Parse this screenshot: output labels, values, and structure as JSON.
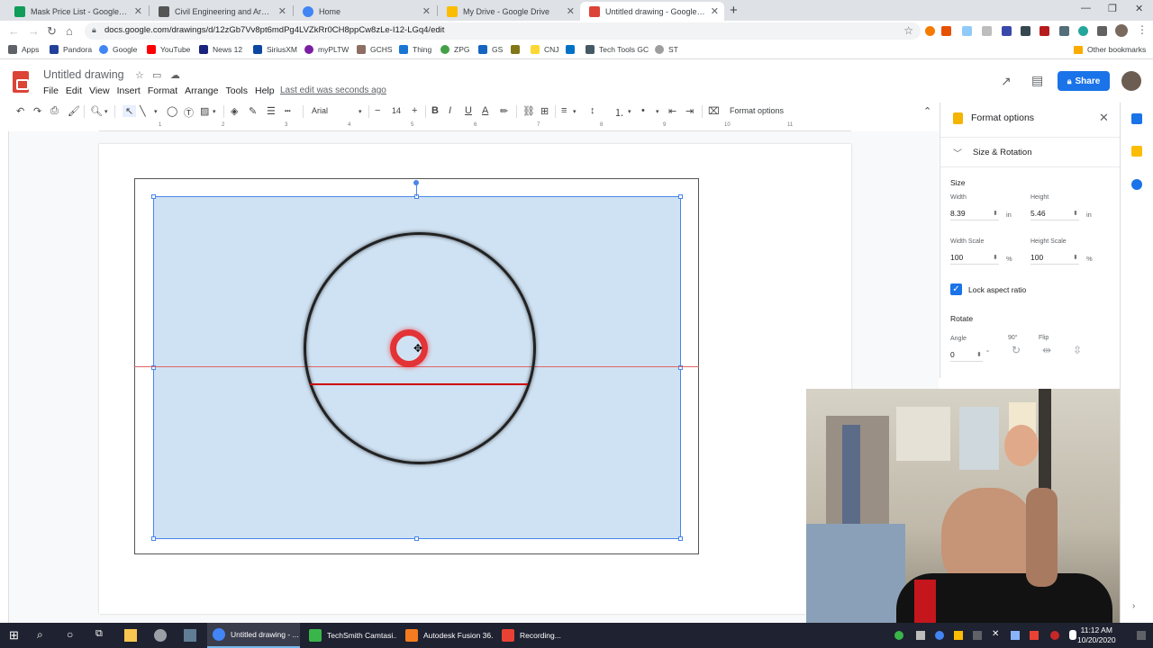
{
  "browser": {
    "tabs": [
      {
        "label": "Mask Price List - Google Sheets",
        "icon": "sheets-icon",
        "color": "#0f9d58",
        "active": false
      },
      {
        "label": "Civil Engineering and Architectu",
        "icon": "cea-icon",
        "color": "#555555",
        "active": false
      },
      {
        "label": "Home",
        "icon": "home-site-icon",
        "color": "#4285f4",
        "active": false
      },
      {
        "label": "My Drive - Google Drive",
        "icon": "drive-icon",
        "color": "#fbbc04",
        "active": false
      },
      {
        "label": "Untitled drawing - Google Drawi",
        "icon": "drawings-icon",
        "color": "#db4437",
        "active": true
      }
    ],
    "url": "docs.google.com/drawings/d/12zGb7Vv8pt6mdPg4LVZkRr0CH8ppCw8zLe-I12-LGq4/edit",
    "bookmarks": [
      "Apps",
      "Pandora",
      "Google",
      "YouTube",
      "News 12",
      "SiriusXM",
      "myPLTW",
      "GCHS",
      "Thing",
      "ZPG",
      "GS",
      "CNJ",
      "Tech Tools GC",
      "ST"
    ],
    "other_bookmarks": "Other bookmarks"
  },
  "doc": {
    "title": "Untitled drawing",
    "menu": [
      "File",
      "Edit",
      "View",
      "Insert",
      "Format",
      "Arrange",
      "Tools",
      "Help"
    ],
    "last_edit": "Last edit was seconds ago",
    "share_label": "Share",
    "share_icon": "lock-icon"
  },
  "toolbar": {
    "font": "Arial",
    "font_size": "14",
    "format_options": "Format options"
  },
  "ruler": {
    "numbers": [
      "1",
      "2",
      "3",
      "4",
      "5",
      "6",
      "7",
      "8",
      "9",
      "10",
      "11"
    ]
  },
  "format_panel": {
    "title": "Format options",
    "section": "Size & Rotation",
    "size_heading": "Size",
    "width_label": "Width",
    "width_value": "8.39",
    "width_unit": "in",
    "height_label": "Height",
    "height_value": "5.46",
    "height_unit": "in",
    "width_scale_label": "Width Scale",
    "width_scale_value": "100",
    "height_scale_label": "Height Scale",
    "height_scale_value": "100",
    "percent": "%",
    "lock_aspect_label": "Lock aspect ratio",
    "lock_aspect_checked": true,
    "rotate_heading": "Rotate",
    "angle_label": "Angle",
    "angle_value": "0",
    "degree": "°",
    "rotate_90_label": "90°",
    "flip_label": "Flip"
  },
  "taskbar": {
    "tasks": [
      {
        "label": "Untitled drawing - ...",
        "color": "#4285f4",
        "active": true
      },
      {
        "label": "TechSmith Camtasi...",
        "color": "#3ab54a",
        "active": false
      },
      {
        "label": "Autodesk Fusion 36...",
        "color": "#f47b20",
        "active": false
      },
      {
        "label": "Recording...",
        "color": "#e94235",
        "active": false
      }
    ],
    "time": "11:12 AM",
    "date": "10/20/2020"
  }
}
